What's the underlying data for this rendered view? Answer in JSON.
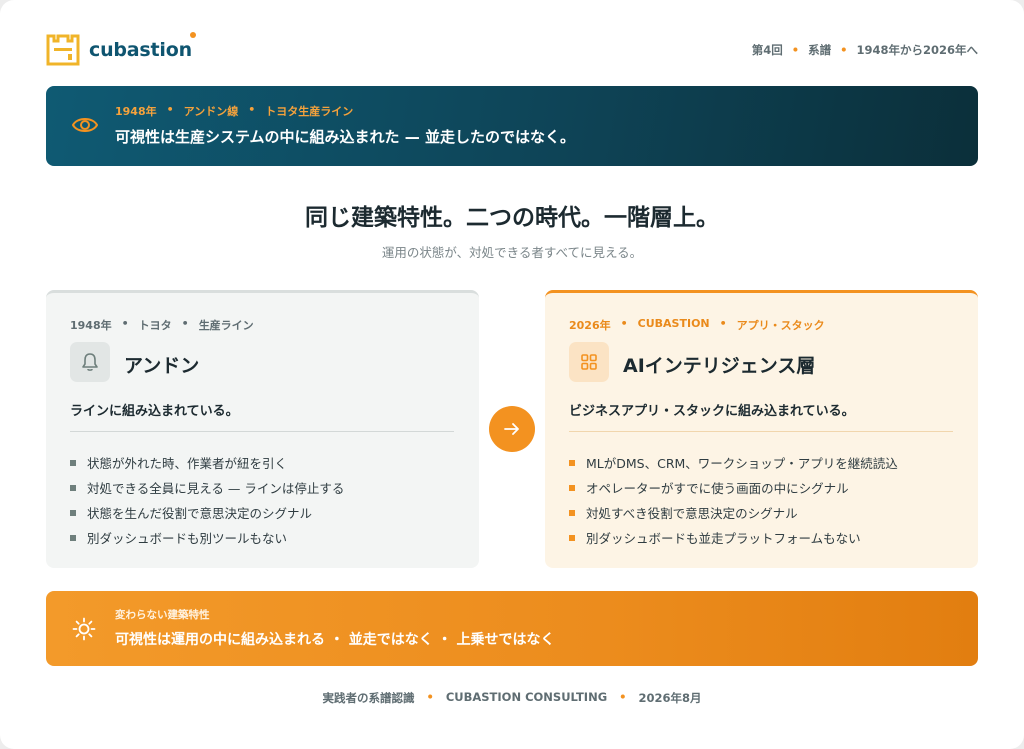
{
  "brand": {
    "name": "cubastion",
    "accent": "#f39220",
    "primary": "#0f5570"
  },
  "header_meta": [
    "第4回",
    "系譜",
    "1948年から2026年へ"
  ],
  "banner": {
    "tag": [
      "1948年",
      "アンドン線",
      "トヨタ生産ライン"
    ],
    "title": "可視性は生産システムの中に組み込まれた — 並走したのではなく。",
    "icon": "eye-icon"
  },
  "headline": "同じ建築特性。二つの時代。一階層上。",
  "subline": "運用の状態が、対処できる者すべてに見える。",
  "cards": {
    "left": {
      "tag": [
        "1948年",
        "トヨタ",
        "生産ライン"
      ],
      "icon": "bell-icon",
      "title": "アンドン",
      "lead": "ラインに組み込まれている。",
      "items": [
        "状態が外れた時、作業者が紐を引く",
        "対処できる全員に見える — ラインは停止する",
        "状態を生んだ役割で意思決定のシグナル",
        "別ダッシュボードも別ツールもない"
      ]
    },
    "right": {
      "tag": [
        "2026年",
        "CUBASTION",
        "アプリ・スタック"
      ],
      "icon": "grid-icon",
      "title": "AIインテリジェンス層",
      "lead": "ビジネスアプリ・スタックに組み込まれている。",
      "items": [
        "MLがDMS、CRM、ワークショップ・アプリを継続読込",
        "オペレーターがすでに使う画面の中にシグナル",
        "対処すべき役割で意思決定のシグナル",
        "別ダッシュボードも並走プラットフォームもない"
      ]
    }
  },
  "arrow_icon": "arrow-right-icon",
  "band": {
    "icon": "sun-icon",
    "tag": "変わらない建築特性",
    "title": "可視性は運用の中に組み込まれる ・ 並走ではなく ・ 上乗せではなく"
  },
  "footer": [
    "実践者の系譜認識",
    "CUBASTION CONSULTING",
    "2026年8月"
  ]
}
